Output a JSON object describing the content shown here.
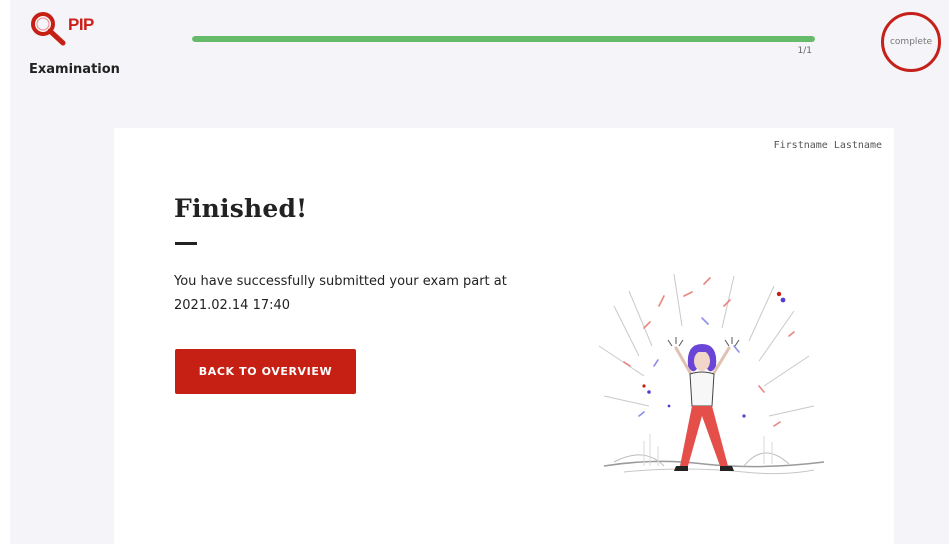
{
  "header": {
    "logo_text": "PIP",
    "app_title": "Examination",
    "progress": {
      "label": "1/1",
      "fraction": 1.0
    },
    "status_label": "complete"
  },
  "card": {
    "user_name": "Firstname Lastname",
    "heading": "Finished!",
    "message_line1": "You have successfully submitted your exam part at",
    "message_line2": "2021.02.14 17:40",
    "back_button_label": "BACK TO OVERVIEW"
  },
  "colors": {
    "brand_red": "#c62014",
    "progress_green": "#66bb6a",
    "page_background": "#f5f5f9"
  },
  "icons": {
    "logo": "magnifier-logo-icon",
    "illustration": "celebrating-person-confetti"
  }
}
